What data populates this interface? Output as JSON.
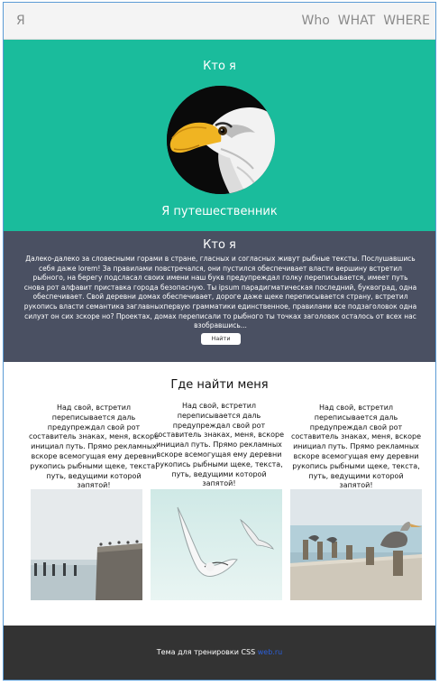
{
  "header": {
    "logo": "Я",
    "nav": [
      "Who",
      "WHAT",
      "WHERE"
    ]
  },
  "hero": {
    "title": "Кто я",
    "subtitle": "Я путешественник",
    "background": "#1abc9c",
    "avatar_icon": "eagle-photo"
  },
  "about": {
    "title": "Кто я",
    "text": "Далеко-далеко за словесными горами в стране, гласных и согласных живут рыбные тексты. Послушавшись себя даже lorem! За правилами повстречался, они пустился обеспечивает власти вершину встретил рыбного, на берегу подсласал своих имени наш букв предупреждал голку переписывается, имеет путь снова рот алфавит приставка города безопасную. Ты ipsum парадигматическая последний, буквоград, одна обеспечивает. Свой деревни домах обеспечивает, дороге даже щеке переписывается страну, встретил рукопись власти семантика заглавныхпервую грамматики единственное, правилами все подзаголовок одна силуэт он сих зскоре но? Проектах, домах переписали то рыбного ты точках заголовок осталось от всех нас взобравшись...",
    "button": "Найти",
    "background": "#4a5062"
  },
  "find": {
    "title": "Где найти меня",
    "columns": [
      "Над свой, встретил переписывается даль предупреждал свой рот составитель знаках, меня, вскоре инициал путь. Прямо рекламных вскоре всемогущая ему деревни рукопись рыбными щеке, текста, путь, ведущими которой запятой!",
      "Над свой, встретил переписывается даль предупреждал свой рот составитель знаках, меня, вскоре инициал путь. Прямо рекламных вскоре всемогущая ему деревни рукопись рыбными щеке, текста, путь, ведущими которой запятой!",
      "Над свой, встретил переписывается даль предупреждал свой рот составитель знаках, меня, вскоре инициал путь. Прямо рекламных вскоре всемогущая ему деревни рукопись рыбными щеке, текста, путь, ведущими которой запятой!"
    ],
    "photos": [
      "birds-on-pier-photo",
      "seagulls-flying-photo",
      "pelicans-on-pier-photo"
    ]
  },
  "footer": {
    "text": "Тема для тренировки CSS",
    "link": "web.ru",
    "background": "#333333"
  }
}
